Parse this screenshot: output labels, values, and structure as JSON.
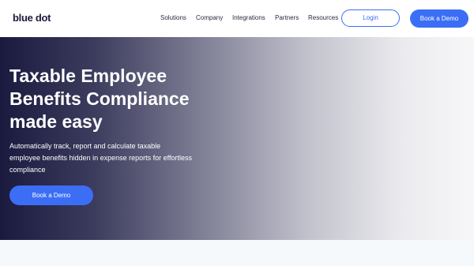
{
  "brand": {
    "name": "blue dot"
  },
  "nav": {
    "items": [
      "Solutions",
      "Company",
      "Integrations",
      "Partners",
      "Resources"
    ],
    "login_label": "Login",
    "demo_label": "Book a Demo"
  },
  "hero": {
    "title_lines": [
      "Taxable Employee",
      "Benefits Compliance",
      "made easy"
    ],
    "subtitle_lines": [
      "Automatically track, report and calculate taxable",
      "employee benefits hidden in expense reports for effortless",
      "compliance"
    ],
    "cta_label": "Book a Demo"
  },
  "colors": {
    "accent": "#3b6ef5",
    "hero_dark": "#1a1a3f"
  }
}
